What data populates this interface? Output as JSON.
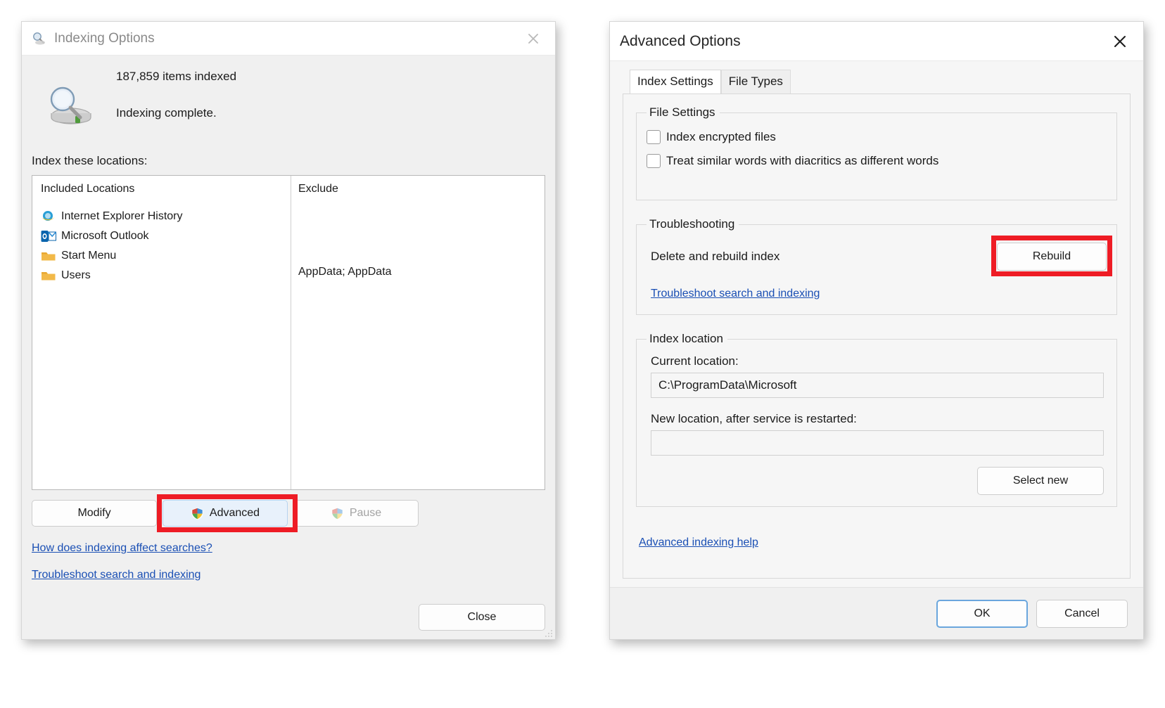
{
  "indexing_options": {
    "title": "Indexing Options",
    "title_icon": "indexing-options-icon",
    "close_icon": "close-icon",
    "status": {
      "icon": "magnifier-drive-icon",
      "items_indexed": "187,859 items indexed",
      "state": "Indexing complete."
    },
    "locations_label": "Index these locations:",
    "list": {
      "col_included_header": "Included Locations",
      "col_exclude_header": "Exclude",
      "rows": [
        {
          "icon": "internet-explorer-icon",
          "included": "Internet Explorer History",
          "exclude": ""
        },
        {
          "icon": "outlook-icon",
          "included": "Microsoft Outlook",
          "exclude": ""
        },
        {
          "icon": "folder-icon",
          "included": "Start Menu",
          "exclude": ""
        },
        {
          "icon": "folder-icon",
          "included": "Users",
          "exclude": "AppData; AppData"
        }
      ]
    },
    "buttons": {
      "modify": "Modify",
      "advanced": "Advanced",
      "pause": "Pause",
      "close": "Close",
      "advanced_shield_icon": "uac-shield-icon",
      "pause_shield_icon": "uac-shield-icon-disabled",
      "advanced_highlighted": true,
      "pause_disabled": true
    },
    "links": [
      "How does indexing affect searches?",
      "Troubleshoot search and indexing"
    ]
  },
  "advanced_options": {
    "title": "Advanced Options",
    "close_icon": "close-icon",
    "tabs": [
      {
        "label": "Index Settings",
        "active": true
      },
      {
        "label": "File Types",
        "active": false
      }
    ],
    "file_settings": {
      "legend": "File Settings",
      "checkboxes": [
        {
          "label": "Index encrypted files",
          "checked": false
        },
        {
          "label": "Treat similar words with diacritics as different words",
          "checked": false
        }
      ]
    },
    "troubleshooting": {
      "legend": "Troubleshooting",
      "row_label": "Delete and rebuild index",
      "rebuild_button": "Rebuild",
      "rebuild_highlighted": true,
      "link": "Troubleshoot search and indexing"
    },
    "index_location": {
      "legend": "Index location",
      "current_label": "Current location:",
      "current_value": "C:\\ProgramData\\Microsoft",
      "new_label": "New location, after service is restarted:",
      "new_value": "",
      "new_placeholder": "",
      "select_new_button": "Select new"
    },
    "help_link": "Advanced indexing help",
    "footer": {
      "ok": "OK",
      "cancel": "Cancel"
    }
  },
  "colors": {
    "highlight_red": "#ee1c25",
    "link_blue": "#1a4fb4",
    "focus_blue": "#6aa6dd"
  }
}
